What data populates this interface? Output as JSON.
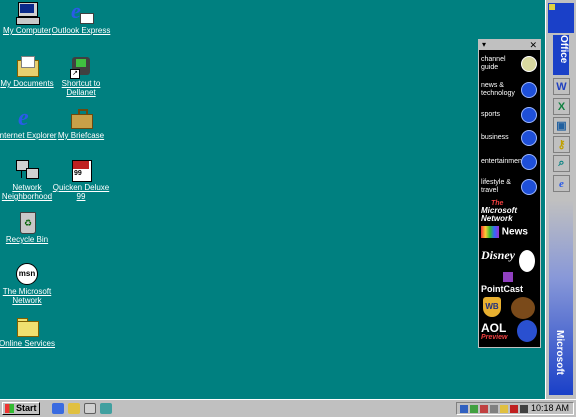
{
  "desktop_icons": [
    {
      "label": "My Computer",
      "icon": "my-computer-icon"
    },
    {
      "label": "Outlook Express",
      "icon": "outlook-express-icon"
    },
    {
      "label": "My Documents",
      "icon": "my-documents-icon"
    },
    {
      "label": "Shortcut to Dellanet",
      "icon": "dellanet-shortcut-icon"
    },
    {
      "label": "Internet Explorer",
      "icon": "internet-explorer-icon"
    },
    {
      "label": "My Briefcase",
      "icon": "briefcase-icon"
    },
    {
      "label": "Network Neighborhood",
      "icon": "network-icon"
    },
    {
      "label": "Quicken Deluxe 99",
      "icon": "quicken-icon"
    },
    {
      "label": "Recycle Bin",
      "icon": "recycle-bin-icon"
    },
    {
      "label": "The Microsoft Network",
      "icon": "msn-icon"
    },
    {
      "label": "Online Services",
      "icon": "folder-icon"
    }
  ],
  "channel_bar": {
    "channels": [
      "channel guide",
      "news & technology",
      "sports",
      "business",
      "entertainment",
      "lifestyle & travel"
    ],
    "brands": {
      "msn_top": "The",
      "msn_main": "Microsoft Network",
      "nbc": "News",
      "pointcast": "PointCast",
      "aol": "AOL",
      "aol_sub": "Preview"
    }
  },
  "office_bar": {
    "label_top": "Office",
    "label_bottom": "Microsoft"
  },
  "taskbar": {
    "start_label": "Start",
    "clock": "10:18 AM"
  }
}
